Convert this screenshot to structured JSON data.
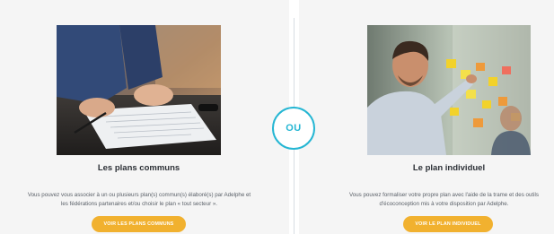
{
  "separator": {
    "label": "OU"
  },
  "left_card": {
    "title": "Les plans communs",
    "description": "Vous pouvez vous associer à un ou plusieurs plan(s) commun(s) élaboré(s) par Adelphe et les fédérations partenaires et/ou choisir le plan « tout secteur ».",
    "button_label": "VOIR LES PLANS COMMUNS"
  },
  "right_card": {
    "title": "Le plan individuel",
    "description": "Vous pouvez formaliser votre propre plan avec l'aide de la trame et des outils d'écoconception mis à votre disposition par Adelphe.",
    "button_label": "VOIR LE PLAN INDIVIDUEL"
  },
  "colors": {
    "accent_button": "#f1b12f",
    "separator_ring": "#25b6d3"
  }
}
